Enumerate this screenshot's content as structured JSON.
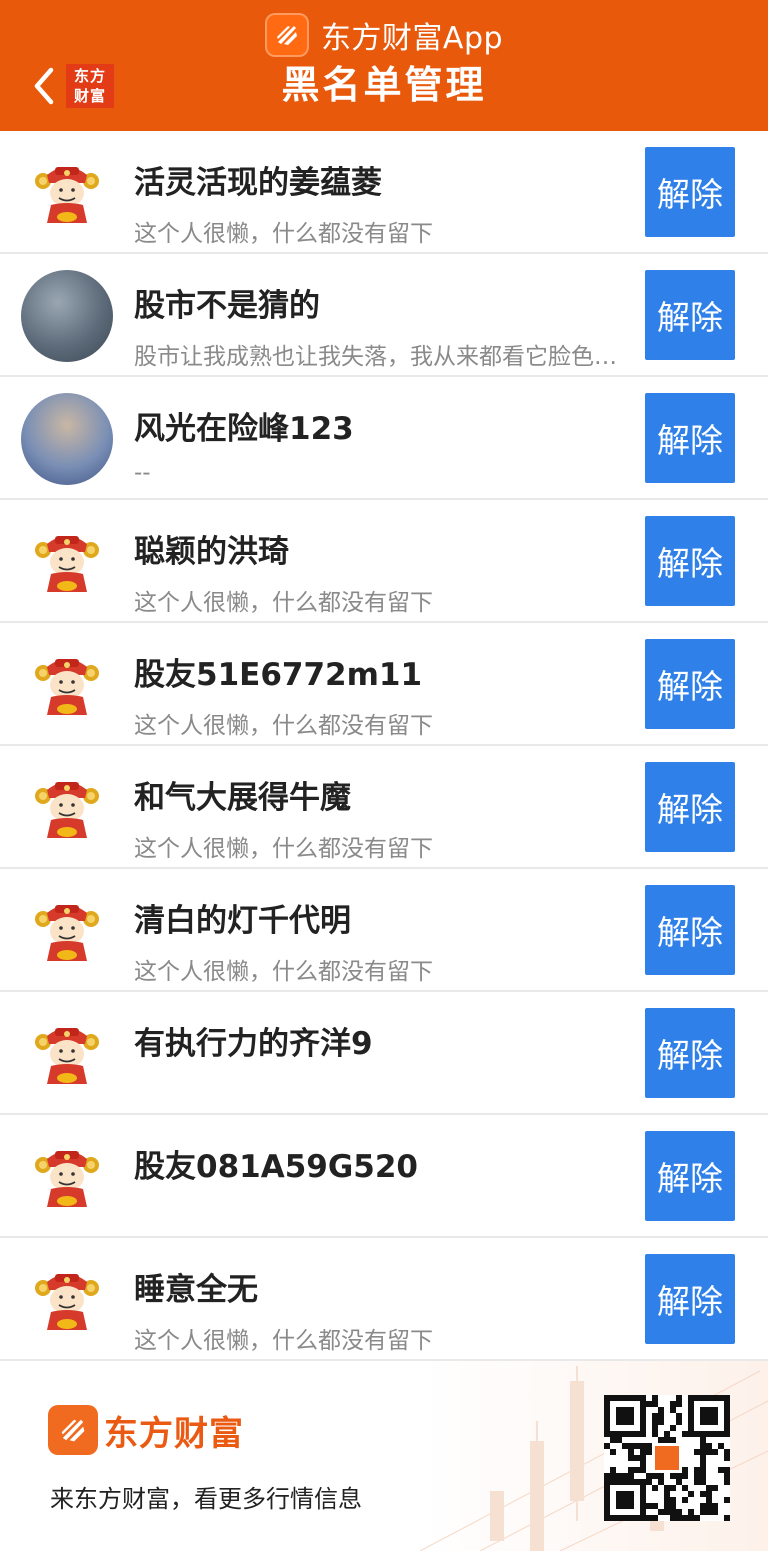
{
  "header": {
    "app_name": "东方财富App",
    "mini_logo_line1": "东方",
    "mini_logo_line2": "财富",
    "title": "黑名单管理",
    "back_icon": "chevron-left-icon"
  },
  "colors": {
    "header_bg": "#e8590c",
    "button_bg": "#2f80e8",
    "brand_orange": "#ea5a12"
  },
  "blacklist": [
    {
      "name": "活灵活现的姜蕴菱",
      "signature": "这个人很懒，什么都没有留下",
      "avatar": "fortune-god-avatar",
      "button": "解除"
    },
    {
      "name": "股市不是猜的",
      "signature": "股市让我成熟也让我失落，我从来都看它脸色行事",
      "avatar": "user-photo-avatar",
      "button": "解除"
    },
    {
      "name": "风光在险峰123",
      "signature": "--",
      "avatar": "user-photo-avatar",
      "button": "解除"
    },
    {
      "name": "聪颖的洪琦",
      "signature": "这个人很懒，什么都没有留下",
      "avatar": "fortune-god-avatar",
      "button": "解除"
    },
    {
      "name": "股友51E6772m11",
      "signature": "这个人很懒，什么都没有留下",
      "avatar": "fortune-god-avatar",
      "button": "解除"
    },
    {
      "name": "和气大展得牛魔",
      "signature": "这个人很懒，什么都没有留下",
      "avatar": "fortune-god-avatar",
      "button": "解除"
    },
    {
      "name": "清白的灯千代明",
      "signature": "这个人很懒，什么都没有留下",
      "avatar": "fortune-god-avatar",
      "button": "解除"
    },
    {
      "name": "有执行力的齐洋9",
      "signature": "",
      "avatar": "fortune-god-avatar",
      "button": "解除"
    },
    {
      "name": "股友081A59G520",
      "signature": "",
      "avatar": "fortune-god-avatar",
      "button": "解除"
    },
    {
      "name": "睡意全无",
      "signature": "这个人很懒，什么都没有留下",
      "avatar": "fortune-god-avatar",
      "button": "解除"
    }
  ],
  "footer": {
    "brand": "东方财富",
    "slogan": "来东方财富，看更多行情信息",
    "qr_icon": "qr-code-icon"
  }
}
